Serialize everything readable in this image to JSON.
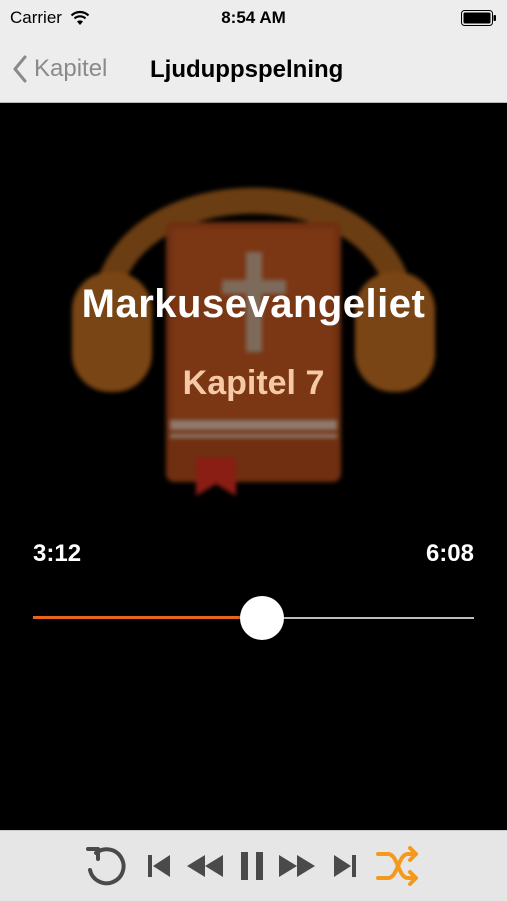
{
  "status_bar": {
    "carrier": "Carrier",
    "time": "8:54 AM",
    "icons": [
      "wifi-icon",
      "battery-icon"
    ]
  },
  "nav": {
    "back_label": "Kapitel",
    "title": "Ljuduppspelning"
  },
  "now_playing": {
    "book": "Markusevangeliet",
    "chapter": "Kapitel 7",
    "artwork_icon": "headphones-bible-icon"
  },
  "progress": {
    "elapsed": "3:12",
    "total": "6:08",
    "fraction": 0.52
  },
  "toolbar": {
    "buttons": [
      "repeat-icon",
      "skip-back-icon",
      "rewind-icon",
      "pause-icon",
      "fast-forward-icon",
      "skip-forward-icon",
      "shuffle-icon"
    ]
  },
  "colors": {
    "accent": "#e8641e",
    "shuffle_active": "#f39a1e",
    "bar_background": "#ededed",
    "chapter_text": "#f5c8a6"
  }
}
